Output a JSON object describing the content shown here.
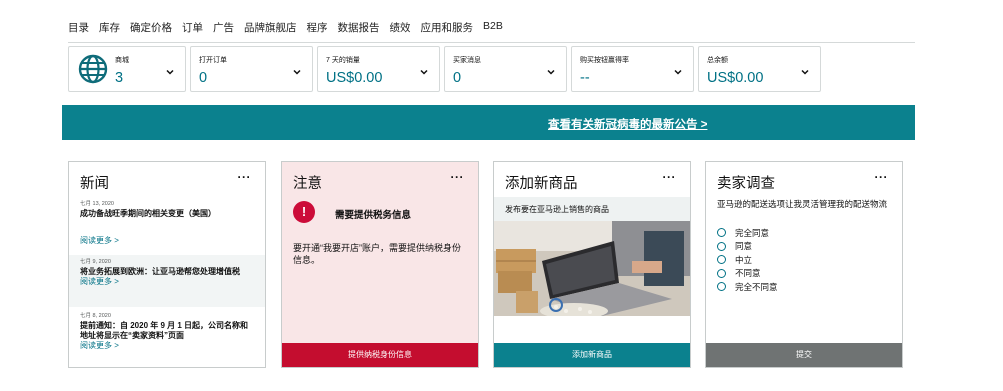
{
  "nav": {
    "items": [
      "目录",
      "库存",
      "确定价格",
      "订单",
      "广告",
      "品牌旗舰店",
      "程序",
      "数据报告",
      "绩效",
      "应用和服务",
      "B2B"
    ]
  },
  "metrics": [
    {
      "label": "商城",
      "value": "3",
      "icon": "globe-icon"
    },
    {
      "label": "打开订单",
      "value": "0"
    },
    {
      "label": "7 天的销量",
      "value": "US$0.00"
    },
    {
      "label": "买家消息",
      "value": "0"
    },
    {
      "label": "购买按钮赢得率",
      "value": "--"
    },
    {
      "label": "总余额",
      "value": "US$0.00"
    }
  ],
  "banner": {
    "link_text": "查看有关新冠病毒的最新公告 >"
  },
  "news": {
    "title": "新闻",
    "more": "···",
    "items": [
      {
        "date": "七月 13, 2020",
        "headline": "成功备战旺季期间的相关变更（美国）",
        "more": "阅读更多 >"
      },
      {
        "date": "七月 9, 2020",
        "headline": "将业务拓展到欧洲：让亚马逊帮您处理增值税",
        "more": "阅读更多 >"
      },
      {
        "date": "七月 8, 2020",
        "headline": "提前通知：自 2020 年 9 月 1 日起，公司名称和地址将显示在“卖家资料”页面",
        "more": "阅读更多 >"
      }
    ]
  },
  "notice": {
    "title": "注意",
    "more": "···",
    "alert_icon": "!",
    "heading": "需要提供税务信息",
    "body": "要开通“我要开店”账户，需要提供纳税身份信息。",
    "button": "提供纳税身份信息"
  },
  "add_product": {
    "title": "添加新商品",
    "more": "···",
    "description": "发布要在亚马逊上销售的商品",
    "button": "添加新商品"
  },
  "survey": {
    "title": "卖家调查",
    "more": "···",
    "question": "亚马逊的配送选项让我灵活管理我的配送物流",
    "options": [
      "完全同意",
      "同意",
      "中立",
      "不同意",
      "完全不同意"
    ],
    "button": "提交"
  },
  "colors": {
    "teal": "#0b818e",
    "link": "#007185",
    "alert_red": "#c40d2f",
    "notice_bg": "#f9e6e7",
    "gray": "#6f7373"
  }
}
